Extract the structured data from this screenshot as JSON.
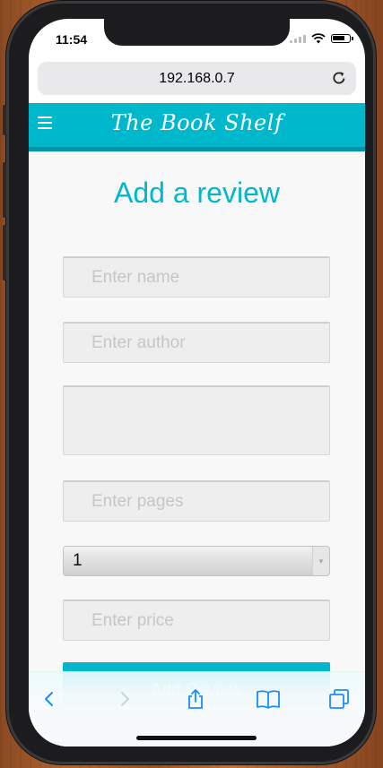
{
  "status_bar": {
    "time": "11:54"
  },
  "browser": {
    "url": "192.168.0.7"
  },
  "header": {
    "brand": "The Book Shelf"
  },
  "form": {
    "title": "Add a review",
    "name_placeholder": "Enter name",
    "author_placeholder": "Enter author",
    "description_placeholder": "",
    "pages_placeholder": "Enter pages",
    "rating_value": "1",
    "price_placeholder": "Enter price",
    "submit_label": "Add Review"
  },
  "colors": {
    "accent": "#00b8cc",
    "accent_dark": "#0296a6",
    "safari_blue": "#1a8cff"
  },
  "icons": {
    "toolbar": [
      "back-icon",
      "forward-icon",
      "share-icon",
      "bookmarks-icon",
      "tabs-icon"
    ],
    "header": [
      "menu-icon"
    ],
    "urlbar": [
      "reload-icon"
    ]
  }
}
